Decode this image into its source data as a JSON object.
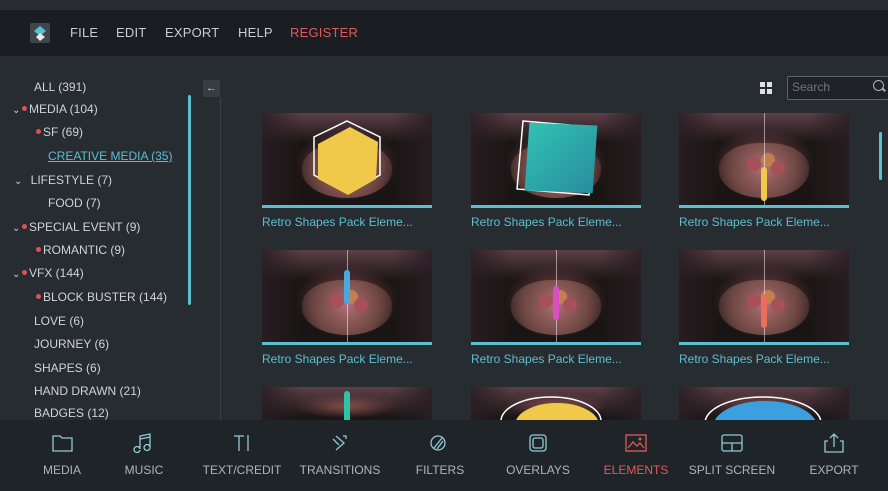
{
  "menu": {
    "items": [
      "FILE",
      "EDIT",
      "EXPORT",
      "HELP",
      "REGISTER"
    ]
  },
  "sidebar": {
    "items": [
      {
        "label": "ALL (391)"
      },
      {
        "label": "MEDIA (104)"
      },
      {
        "label": "SF (69)"
      },
      {
        "label": "CREATIVE MEDIA (35)"
      },
      {
        "label": "LIFESTYLE (7)"
      },
      {
        "label": "FOOD (7)"
      },
      {
        "label": "SPECIAL EVENT (9)"
      },
      {
        "label": "ROMANTIC (9)"
      },
      {
        "label": "VFX (144)"
      },
      {
        "label": "BLOCK BUSTER (144)"
      },
      {
        "label": "LOVE (6)"
      },
      {
        "label": "JOURNEY (6)"
      },
      {
        "label": "SHAPES (6)"
      },
      {
        "label": "HAND DRAWN (21)"
      },
      {
        "label": "BADGES (12)"
      }
    ],
    "collapse_icon": "arrow-left-icon"
  },
  "search": {
    "placeholder": "Search"
  },
  "tiles": [
    {
      "caption": "Retro Shapes Pack Eleme..."
    },
    {
      "caption": "Retro Shapes Pack Eleme..."
    },
    {
      "caption": "Retro Shapes Pack Eleme..."
    },
    {
      "caption": "Retro Shapes Pack Eleme..."
    },
    {
      "caption": "Retro Shapes Pack Eleme..."
    },
    {
      "caption": "Retro Shapes Pack Eleme..."
    },
    {
      "caption": ""
    },
    {
      "caption": ""
    },
    {
      "caption": ""
    }
  ],
  "toolbar": {
    "items": [
      {
        "label": "MEDIA",
        "icon": "folder-icon"
      },
      {
        "label": "MUSIC",
        "icon": "music-note-icon"
      },
      {
        "label": "TEXT/CREDIT",
        "icon": "text-cursor-icon"
      },
      {
        "label": "TRANSITIONS",
        "icon": "transition-icon"
      },
      {
        "label": "FILTERS",
        "icon": "filter-icon"
      },
      {
        "label": "OVERLAYS",
        "icon": "overlay-icon"
      },
      {
        "label": "ELEMENTS",
        "icon": "image-icon"
      },
      {
        "label": "SPLIT SCREEN",
        "icon": "split-screen-icon"
      },
      {
        "label": "EXPORT",
        "icon": "share-icon"
      }
    ]
  },
  "colors": {
    "accent": "#5bbfd0",
    "active": "#e05a5a",
    "background": "#272c31"
  }
}
